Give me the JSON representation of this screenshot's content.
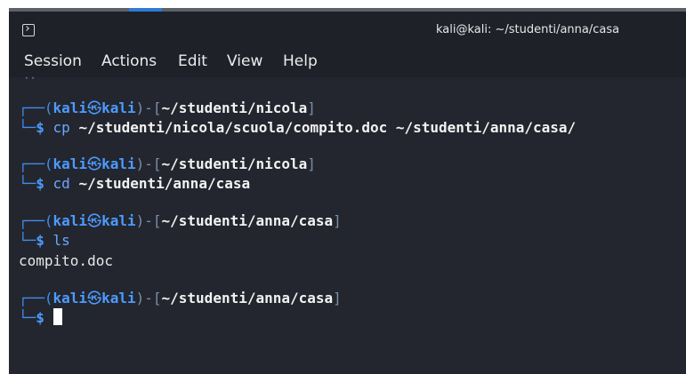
{
  "window": {
    "title": "kali@kali: ~/studenti/anna/casa",
    "app_icon": "terminal-icon"
  },
  "menu": {
    "items": [
      "Session",
      "Actions",
      "Edit",
      "View",
      "Help"
    ]
  },
  "terminal": {
    "prompts": [
      {
        "user": "kali",
        "host": "kali",
        "cwd": "~/studenti/nicola",
        "command": "cp",
        "args": "~/studenti/nicola/scuola/compito.doc ~/studenti/anna/casa/"
      },
      {
        "user": "kali",
        "host": "kali",
        "cwd": "~/studenti/nicola",
        "command": "cd",
        "args": "~/studenti/anna/casa"
      },
      {
        "user": "kali",
        "host": "kali",
        "cwd": "~/studenti/anna/casa",
        "command": "ls",
        "args": "",
        "output": "compito.doc"
      },
      {
        "user": "kali",
        "host": "kali",
        "cwd": "~/studenti/anna/casa",
        "command": "",
        "args": ""
      }
    ],
    "symbols": {
      "frame_top": "┌──(",
      "at": "㉿",
      "mid": ")-[",
      "close": "]",
      "frame_bottom": "└─",
      "dollar": "$"
    }
  },
  "colors": {
    "background": "#23262e",
    "titlebar": "#1f2129",
    "prompt_blue": "#4d9bff",
    "text": "#f2f2f2"
  }
}
